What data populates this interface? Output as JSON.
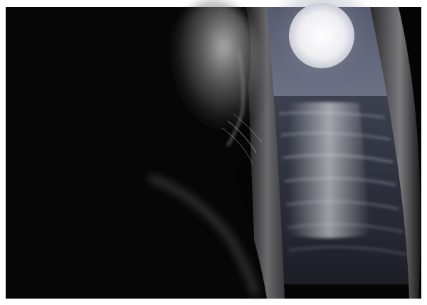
{
  "scene": {
    "subject": "woman-silhouette-at-window",
    "elements": [
      "full-moon",
      "night-sky",
      "sea",
      "moonlight-reflection",
      "curtains",
      "window-frame"
    ]
  },
  "colors": {
    "sky": "#5f6478",
    "sea": "#2e3240",
    "moon": "#f2f2f4",
    "shadow": "#050505",
    "curtain": "#3a3a3c",
    "border": "#ffffff"
  }
}
